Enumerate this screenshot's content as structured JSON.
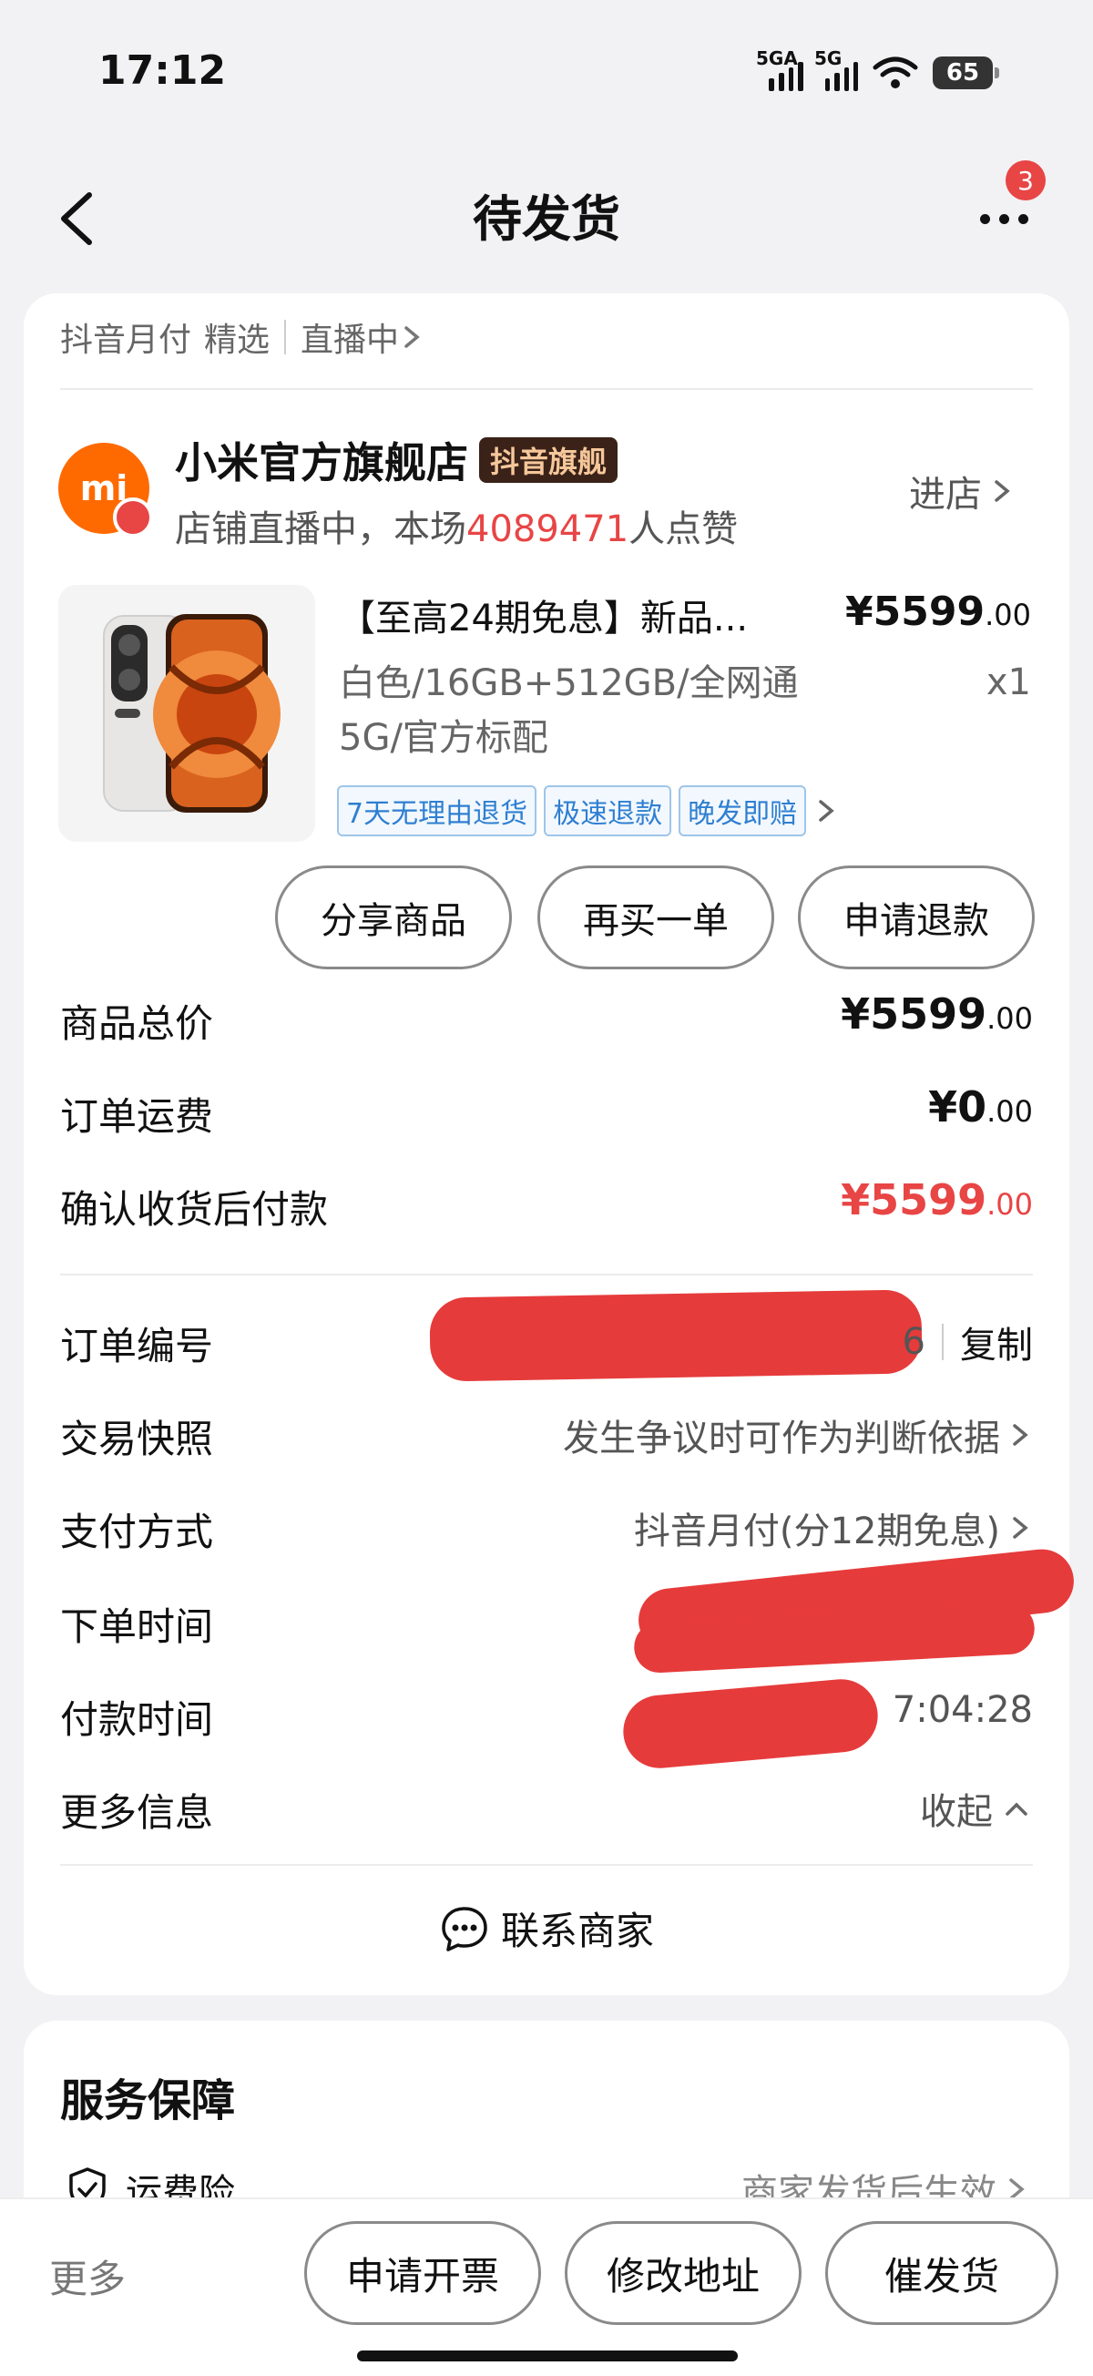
{
  "status": {
    "time": "17:12",
    "net1": "5GA",
    "net2": "5G",
    "battery": "65"
  },
  "nav": {
    "title": "待发货",
    "badge": "3"
  },
  "tags": {
    "pay": "抖音月付",
    "featured": "精选",
    "live": "直播中"
  },
  "store": {
    "name": "小米官方旗舰店",
    "badge": "抖音旗舰",
    "sub_prefix": "店铺直播中，本场",
    "likes": "4089471",
    "sub_suffix": "人点赞",
    "enter": "进店",
    "logo_text": "mi"
  },
  "product": {
    "title": "【至高24期免息】新品...",
    "price_int": "¥5599",
    "price_dec": ".00",
    "spec": "白色/16GB+512GB/全网通5G/官方标配",
    "qty": "x1",
    "service_tags": [
      "7天无理由退货",
      "极速退款",
      "晚发即赔"
    ]
  },
  "actions": {
    "share": "分享商品",
    "rebuy": "再买一单",
    "refund": "申请退款"
  },
  "prices": {
    "total_label": "商品总价",
    "total_int": "¥5599",
    "total_dec": ".00",
    "shipping_label": "订单运费",
    "shipping_int": "¥0",
    "shipping_dec": ".00",
    "pay_label": "确认收货后付款",
    "pay_int": "¥5599",
    "pay_dec": ".00"
  },
  "info": {
    "order_label": "订单编号",
    "order_tail": "6",
    "copy": "复制",
    "snapshot_label": "交易快照",
    "snapshot_value": "发生争议时可作为判断依据",
    "method_label": "支付方式",
    "method_value": "抖音月付(分12期免息)",
    "order_time_label": "下单时间",
    "pay_time_label": "付款时间",
    "pay_time_tail": "7:04:28",
    "more_label": "更多信息",
    "collapse": "收起"
  },
  "contact": "联系商家",
  "service": {
    "title": "服务保障",
    "item": "运费险",
    "item_value": "商家发货后生效"
  },
  "bottom": {
    "more": "更多",
    "invoice": "申请开票",
    "address": "修改地址",
    "urge": "催发货"
  },
  "colors": {
    "accent_red": "#e84545",
    "brand_orange": "#ff6a00",
    "tag_blue": "#2f7fd1"
  }
}
